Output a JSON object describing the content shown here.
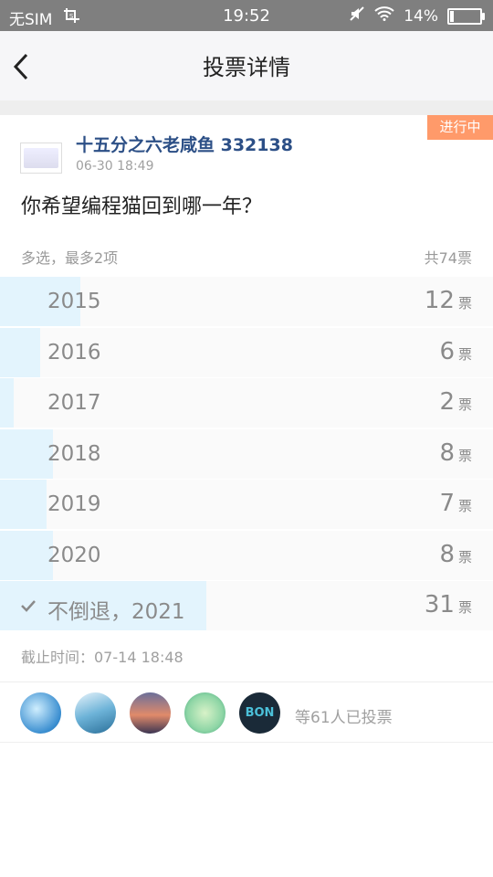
{
  "status": {
    "carrier": "无SIM",
    "time": "19:52",
    "battery": "14%",
    "battery_level": 0.14
  },
  "nav": {
    "title": "投票详情"
  },
  "poll": {
    "badge": "进行中",
    "author": "十五分之六老咸鱼 332138",
    "date": "06-30 18:49",
    "question": "你希望编程猫回到哪一年？",
    "mode": "多选，最多2项",
    "total": "共74票",
    "total_votes": 74,
    "unit": "票",
    "options": [
      {
        "label": "2015",
        "count": "12",
        "votes": 12,
        "checked": false
      },
      {
        "label": "2016",
        "count": "6",
        "votes": 6,
        "checked": false
      },
      {
        "label": "2017",
        "count": "2",
        "votes": 2,
        "checked": false
      },
      {
        "label": "2018",
        "count": "8",
        "votes": 8,
        "checked": false
      },
      {
        "label": "2019",
        "count": "7",
        "votes": 7,
        "checked": false
      },
      {
        "label": "2020",
        "count": "8",
        "votes": 8,
        "checked": false
      },
      {
        "label": "不倒退，2021",
        "count": "31",
        "votes": 31,
        "checked": true
      }
    ],
    "deadline": "截止时间：07-14 18:48",
    "voters_text": "等61人已投票"
  },
  "colors": {
    "accent_badge": "#ff9a6a",
    "bar_fill": "#e3f4fd",
    "author": "#2c4f86"
  }
}
